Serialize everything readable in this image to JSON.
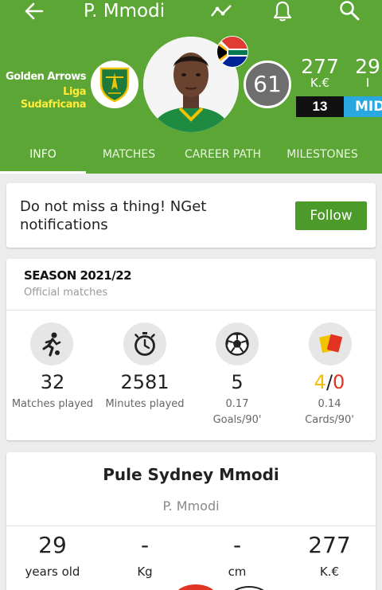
{
  "header": {
    "title": "P. Mmodi",
    "icons": [
      "back-arrow-icon",
      "stats-line-icon",
      "bell-icon",
      "search-icon"
    ],
    "club_name": "Golden Arrows",
    "league": "Liga Sudafricana",
    "rating": "61",
    "value": "277",
    "value_unit": "K.€",
    "age": "29",
    "age_unit": "I",
    "shirt_number": "13",
    "position": "MID"
  },
  "tabs": [
    {
      "label": "INFO",
      "active": true
    },
    {
      "label": "MATCHES",
      "active": false
    },
    {
      "label": "CAREER PATH",
      "active": false
    },
    {
      "label": "MILESTONES",
      "active": false
    }
  ],
  "notification": {
    "text": "Do not miss a thing!  NGet notifications",
    "button": "Follow"
  },
  "season": {
    "title": "SEASON 2021/22",
    "subtitle": "Official matches",
    "stats": [
      {
        "value": "32",
        "label": "Matches played",
        "icon": "player-running-icon"
      },
      {
        "value": "2581",
        "label": "Minutes played",
        "icon": "stopwatch-icon"
      },
      {
        "value": "5",
        "label": "0.17",
        "label2": "Goals/90'",
        "icon": "soccer-ball-icon"
      },
      {
        "value_yellow": "4",
        "value_sep": "/",
        "value_red": "0",
        "label": "0.14",
        "label2": "Cards/90'",
        "icon": "cards-icon"
      }
    ]
  },
  "profile": {
    "full_name": "Pule Sydney Mmodi",
    "short_name": "P. Mmodi",
    "facts": [
      {
        "value": "29",
        "label": "years old"
      },
      {
        "value": "-",
        "label": "Kg"
      },
      {
        "value": "-",
        "label": "cm"
      },
      {
        "value": "277",
        "label": "K.€"
      }
    ]
  },
  "colors": {
    "brand_green": "#5ba634",
    "button_green": "#4c9a2a",
    "position_blue": "#29a8e0",
    "rating_gray": "#6e6e6e",
    "card_yellow": "#f0c000",
    "card_red": "#e23222"
  }
}
